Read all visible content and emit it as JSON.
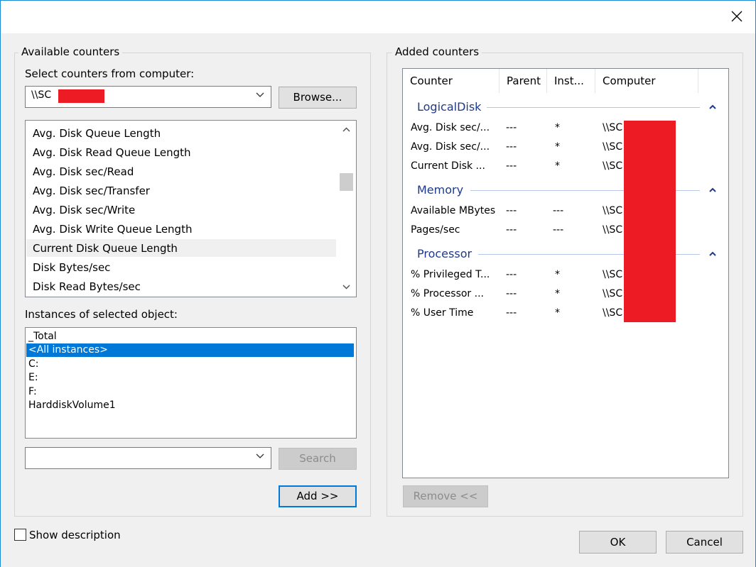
{
  "window": {
    "close_icon": "close-icon"
  },
  "available": {
    "legend": "Available counters",
    "select_label": "Select counters from computer:",
    "computer_value": "\\\\SC",
    "browse_label": "Browse...",
    "counters": [
      "Avg. Disk Queue Length",
      "Avg. Disk Read Queue Length",
      "Avg. Disk sec/Read",
      "Avg. Disk sec/Transfer",
      "Avg. Disk sec/Write",
      "Avg. Disk Write Queue Length",
      "Current Disk Queue Length",
      "Disk Bytes/sec",
      "Disk Read Bytes/sec"
    ],
    "highlighted_counter": "Current Disk Queue Length",
    "instances_label": "Instances of selected object:",
    "instances": [
      "_Total",
      "<All instances>",
      "C:",
      "E:",
      "F:",
      "HarddiskVolume1"
    ],
    "selected_instance": "<All instances>",
    "search_value": "",
    "search_label": "Search",
    "add_label": "Add >>"
  },
  "added": {
    "legend": "Added counters",
    "columns": [
      "Counter",
      "Parent",
      "Inst...",
      "Computer"
    ],
    "groups": [
      {
        "name": "LogicalDisk",
        "rows": [
          {
            "counter": "Avg. Disk sec/...",
            "parent": "---",
            "inst": "*",
            "computer": "\\\\SC"
          },
          {
            "counter": "Avg. Disk sec/...",
            "parent": "---",
            "inst": "*",
            "computer": "\\\\SC"
          },
          {
            "counter": "Current Disk ...",
            "parent": "---",
            "inst": "*",
            "computer": "\\\\SC"
          }
        ]
      },
      {
        "name": "Memory",
        "rows": [
          {
            "counter": "Available MBytes",
            "parent": "---",
            "inst": "---",
            "computer": "\\\\SC"
          },
          {
            "counter": "Pages/sec",
            "parent": "---",
            "inst": "---",
            "computer": "\\\\SC"
          }
        ]
      },
      {
        "name": "Processor",
        "rows": [
          {
            "counter": "% Privileged T...",
            "parent": "---",
            "inst": "*",
            "computer": "\\\\SC"
          },
          {
            "counter": "% Processor ...",
            "parent": "---",
            "inst": "*",
            "computer": "\\\\SC"
          },
          {
            "counter": "% User Time",
            "parent": "---",
            "inst": "*",
            "computer": "\\\\SC"
          }
        ]
      }
    ],
    "remove_label": "Remove <<"
  },
  "footer": {
    "show_description_label": "Show description",
    "show_description_checked": false,
    "ok_label": "OK",
    "cancel_label": "Cancel"
  },
  "colors": {
    "selection": "#0078d7",
    "group_header": "#1e3a8a",
    "redaction": "#ed1c24"
  }
}
